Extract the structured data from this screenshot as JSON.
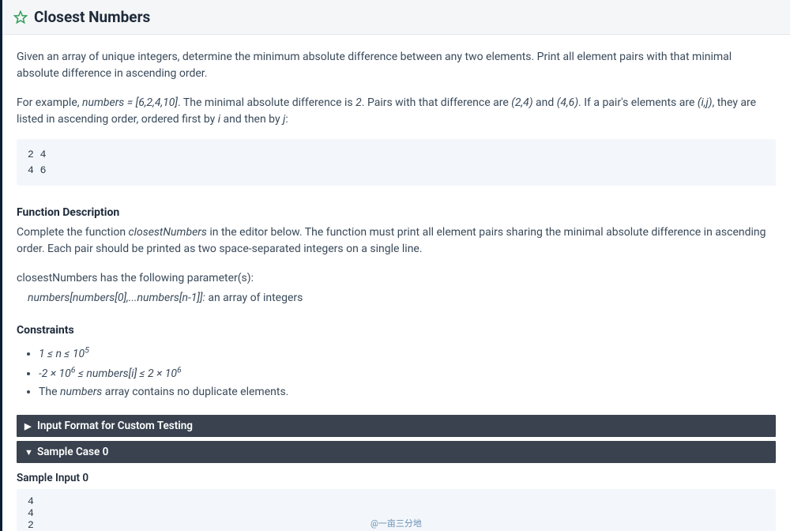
{
  "header": {
    "title": "Closest Numbers"
  },
  "intro": {
    "p1": "Given an array of unique integers, determine the minimum absolute difference between any two elements. Print all element pairs with that minimal absolute difference in ascending order.",
    "p2_a": "For example, ",
    "p2_b": "numbers = [6,2,4,10]",
    "p2_c": ". The minimal absolute difference is ",
    "p2_d": "2",
    "p2_e": ". Pairs with that difference are ",
    "p2_f": "(2,4)",
    "p2_g": " and ",
    "p2_h": "(4,6)",
    "p2_i": ". If a pair's elements are ",
    "p2_j": "(i,j)",
    "p2_k": ", they are listed in ascending order, ordered first by ",
    "p2_l": "i",
    "p2_m": " and then by ",
    "p2_n": "j",
    "p2_o": ":"
  },
  "example_output": "2 4\n4 6",
  "func": {
    "heading": "Function Description",
    "desc_a": "Complete the function ",
    "desc_b": "closestNumbers",
    "desc_c": " in the editor below. The function must print all element pairs sharing the minimal absolute difference in ascending order. Each pair should be printed as two space-separated integers on a single line.",
    "params_intro": "closestNumbers has the following parameter(s):",
    "param_sig": "numbers[numbers[0],...numbers[n-1]]:",
    "param_desc": "  an array of integers"
  },
  "constraints": {
    "heading": "Constraints",
    "items_html": [
      "<span class='ital'>1 ≤ n ≤ 10<sup>5</sup></span>",
      "<span class='ital'>-2 × 10<sup>6</sup> ≤ numbers[i] ≤ 2 × 10<sup>6</sup></span>",
      "The <span class='ital'>numbers</span> array contains no duplicate elements."
    ]
  },
  "accordions": {
    "input_format": "Input Format for Custom Testing",
    "sample_case": "Sample Case 0"
  },
  "sample": {
    "input_heading": "Sample Input 0",
    "input": "4\n4\n2"
  },
  "watermark": "@一亩三分地"
}
